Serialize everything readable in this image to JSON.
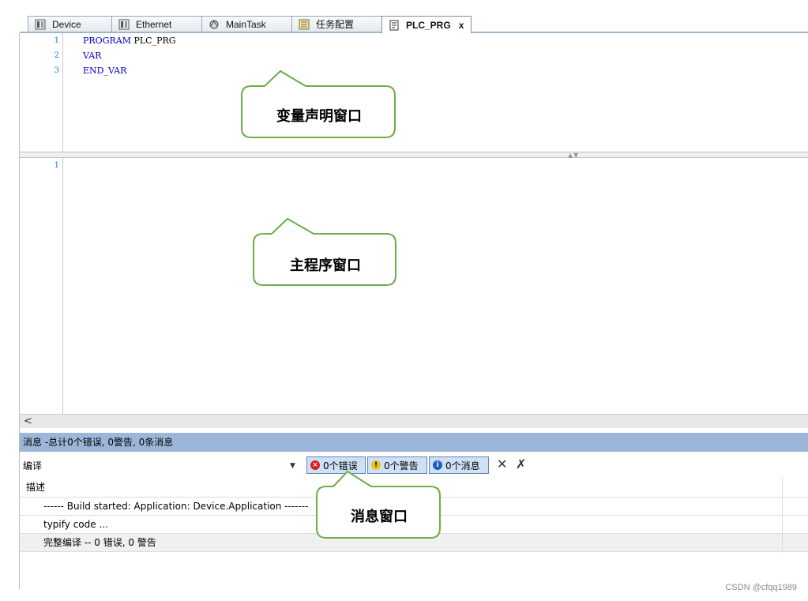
{
  "tabs": [
    {
      "label": "Device",
      "icon": "device-icon",
      "active": false
    },
    {
      "label": "Ethernet",
      "icon": "ethernet-icon",
      "active": false
    },
    {
      "label": "MainTask",
      "icon": "task-icon",
      "active": false
    },
    {
      "label": "任务配置",
      "icon": "task-config-icon",
      "active": false
    },
    {
      "label": "PLC_PRG",
      "icon": "program-icon",
      "active": true,
      "close": "x"
    }
  ],
  "declaration": {
    "line_numbers": [
      "1",
      "2",
      "3"
    ],
    "lines": [
      {
        "keyword": "PROGRAM",
        "rest": " PLC_PRG"
      },
      {
        "keyword": "VAR",
        "rest": ""
      },
      {
        "keyword": "END_VAR",
        "rest": ""
      }
    ]
  },
  "body": {
    "line_numbers": [
      "1"
    ]
  },
  "scrollbar": {
    "left_arrow": "<"
  },
  "messages": {
    "title": "消息 -总计0个错误, 0警告, 0条消息",
    "category": "编译",
    "filters": {
      "errors": "0个错误",
      "warnings": "0个警告",
      "messages": "0个消息"
    },
    "column_description": "描述",
    "rows": [
      "------ Build started: Application: Device.Application -------",
      "typify code ...",
      "完整编译 -- 0 错误, 0 警告"
    ]
  },
  "callouts": {
    "declaration": "变量声明窗口",
    "main": "主程序窗口",
    "messages": "消息窗口"
  },
  "colors": {
    "callout_border": "#6aae45",
    "message_title_bg": "#9bb6d8",
    "keyword": "#0000c8",
    "line_number": "#1c7dd6"
  },
  "watermark": "CSDN @cfqq1989"
}
